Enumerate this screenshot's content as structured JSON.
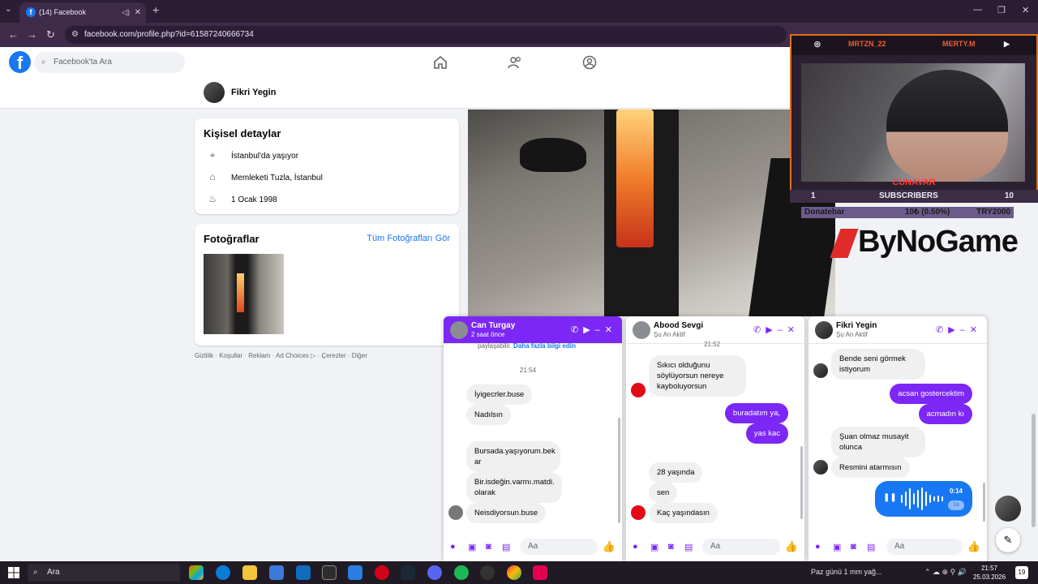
{
  "browser": {
    "tab_title": "(14) Facebook",
    "url": "facebook.com/profile.php?id=61587240666734"
  },
  "fb": {
    "logo": "f",
    "search_placeholder": "Facebook'ta Ara",
    "profile_name": "Fikri Yegin",
    "details_title": "Kişisel detaylar",
    "details": [
      {
        "icon": "location-icon",
        "text": "İstanbul'da yaşıyor"
      },
      {
        "icon": "home-icon",
        "text": "Memleketi Tuzla, İstanbul"
      },
      {
        "icon": "cake-icon",
        "text": "1 Ocak 1998"
      }
    ],
    "photos_title": "Fotoğraflar",
    "photos_see_all": "Tüm Fotoğrafları Gör",
    "footer": "Gizlilik · Koşullar · Reklam · Ad Choices ▷ · Çerezler · Diğer"
  },
  "stream": {
    "handle_left": "MRTZN_22",
    "handle_right": "MERTY.M",
    "nameplate": "CUNAVAR",
    "subs_left": "1",
    "subs_label": "SUBSCRIBERS",
    "subs_right": "10",
    "donate_left": "Donatebar",
    "donate_mid": "10₺ (0.50%)",
    "donate_right": "TRY2000",
    "brand": "ByNoGame"
  },
  "chats": [
    {
      "name": "Can Turgay",
      "status": "2 saat önce",
      "top_text": "paylaşabilir.",
      "top_link": "Daha fazla bilgi edin",
      "time": "21:54",
      "messages": [
        "İyigecrler.buse",
        "Nadılsın",
        "Bursada.yaşıyorum.bek ar",
        "Bir.isdeğin.varmı.matdi. olarak",
        "Neisdiyorsun.buse"
      ]
    },
    {
      "name": "Abood Sevgi",
      "status": "Şu An Aktif",
      "time": "21:52",
      "messages_in1": "Sıkıcı olduğunu söylüyorsun nereye kayboluyorsun",
      "messages_out": [
        "buradatım ya,",
        "yas kac"
      ],
      "messages_in2": [
        "28 yaşında",
        "sen",
        "Kaç yaşındasın"
      ]
    },
    {
      "name": "Fikri Yegin",
      "status": "Şu An Aktif",
      "msg_in1": "Bende seni görmek istiyorum",
      "msg_out": [
        "acsan gostercektim",
        "acmadın kı"
      ],
      "msg_in2": [
        "Şuan olmaz musayit olunca",
        "Resmini atarmısın"
      ],
      "voice_duration": "0:14",
      "voice_speed": "1x"
    }
  ],
  "composer_placeholder": "Aa",
  "taskbar": {
    "search": "Ara",
    "weather": "Paz günü 1 mm yağ...",
    "time": "21:57",
    "date": "25.03.2026",
    "notifications": "19"
  },
  "colors": {
    "messenger": "#7c27f5",
    "facebook": "#1877f2",
    "stream_accent": "#e2701f"
  }
}
